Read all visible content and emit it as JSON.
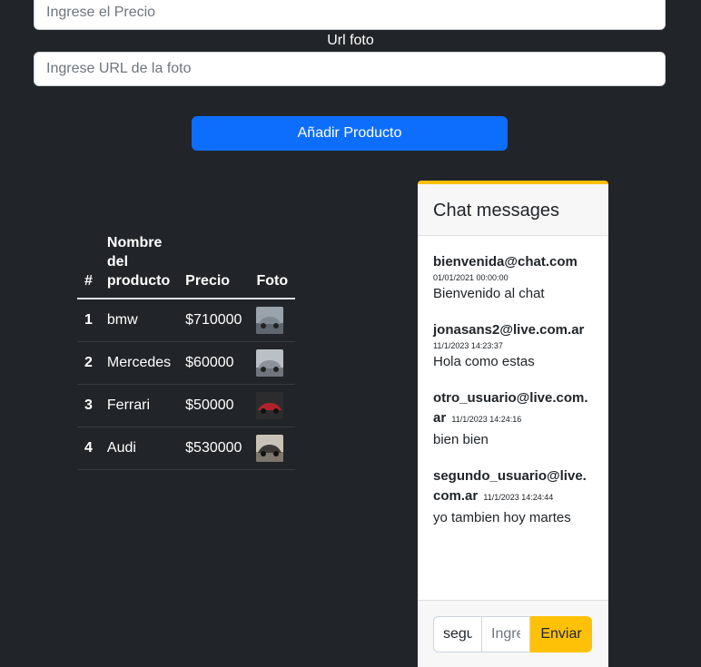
{
  "form": {
    "price_placeholder": "Ingrese el Precio",
    "url_label": "Url foto",
    "url_placeholder": "Ingrese URL de la foto",
    "add_button": "Añadir Producto"
  },
  "table": {
    "headers": [
      "#",
      "Nombre del producto",
      "Precio",
      "Foto"
    ],
    "rows": [
      {
        "num": "1",
        "name": "bmw",
        "price": "$710000",
        "photo_color": "#7c8791"
      },
      {
        "num": "2",
        "name": "Mercedes",
        "price": "$60000",
        "photo_color": "#8c929a"
      },
      {
        "num": "3",
        "name": "Ferrari",
        "price": "$50000",
        "photo_color": "#b1232b"
      },
      {
        "num": "4",
        "name": "Audi",
        "price": "$530000",
        "photo_color": "#3e3b36"
      }
    ]
  },
  "chat": {
    "title": "Chat messages",
    "messages": [
      {
        "email": "bienvenida@chat.com",
        "date": "01/01/2021 00:00:00",
        "text": "Bienvenido al chat"
      },
      {
        "email": "jonasans2@live.com.ar",
        "date": "11/1/2023 14:23:37",
        "text": "Hola como estas"
      },
      {
        "email": "otro_usuario@live.com.ar",
        "date": "11/1/2023 14:24:16",
        "text": "bien bien"
      },
      {
        "email": "segundo_usuario@live.com.ar",
        "date": "11/1/2023 14:24:44",
        "text": "yo tambien hoy martes"
      }
    ],
    "user_value": "segundo_usuario@live.com.ar",
    "message_placeholder": "Ingrese mensaje",
    "send_button": "Enviar"
  },
  "colors": {
    "background": "#212529",
    "primary": "#0d6efd",
    "warning": "#ffc107"
  }
}
